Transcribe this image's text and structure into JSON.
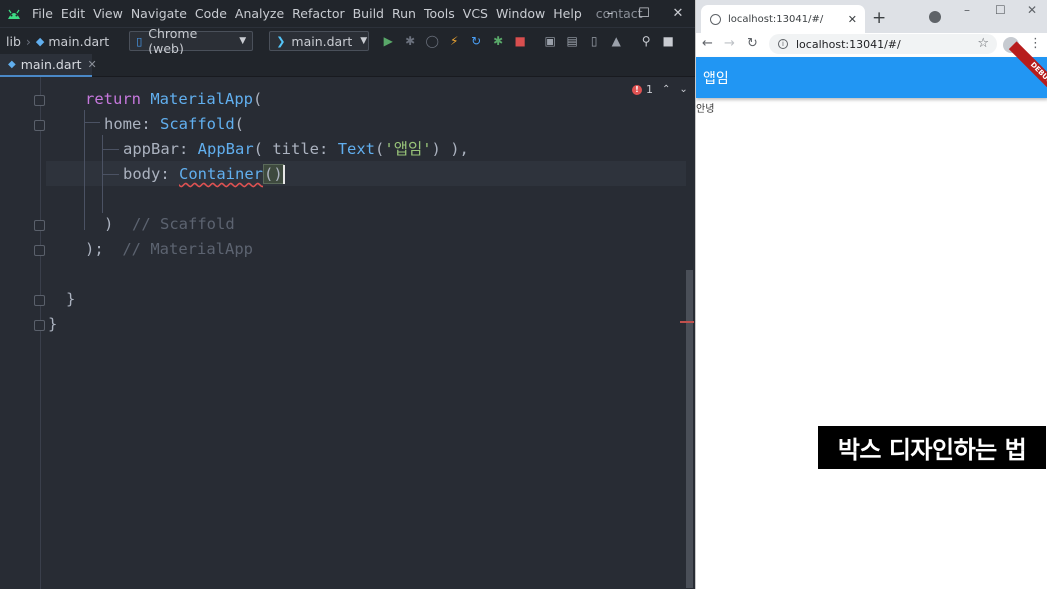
{
  "ide": {
    "menu": [
      "File",
      "Edit",
      "View",
      "Navigate",
      "Code",
      "Analyze",
      "Refactor",
      "Build",
      "Run",
      "Tools",
      "VCS",
      "Window",
      "Help"
    ],
    "project_name": "contact",
    "breadcrumb": [
      "lib",
      "main.dart"
    ],
    "device_selector": "Chrome (web)",
    "run_config": "main.dart",
    "open_tab": "main.dart",
    "error_count": "1",
    "code": {
      "l1_kw": "return",
      "l1_cls": "MaterialApp",
      "l1_rest": "(",
      "l2_param": "home:",
      "l2_cls": "Scaffold",
      "l2_rest": "(",
      "l3_param": "appBar:",
      "l3_cls": "AppBar",
      "l3_mid": "( ",
      "l3_param2": "title:",
      "l3_cls2": "Text",
      "l3_open": "(",
      "l3_str": "'앱임'",
      "l3_close": ") ),",
      "l4_param": "body:",
      "l4_cls": "Container",
      "l4_rest": "()",
      "l6_paren": ")",
      "l6_cmt": "// Scaffold",
      "l7_paren": ");",
      "l7_cmt": "// MaterialApp",
      "l9": "}",
      "l10": "}"
    }
  },
  "browser": {
    "tab_title": "localhost:13041/#/",
    "url": "localhost:13041/#/",
    "app_title": "앱임",
    "debug_banner": "DEBUG",
    "body_text": "안녕"
  },
  "caption": "박스 디자인하는 법",
  "colors": {
    "appbar": "#2196f3",
    "ide_bg": "#282c34"
  }
}
